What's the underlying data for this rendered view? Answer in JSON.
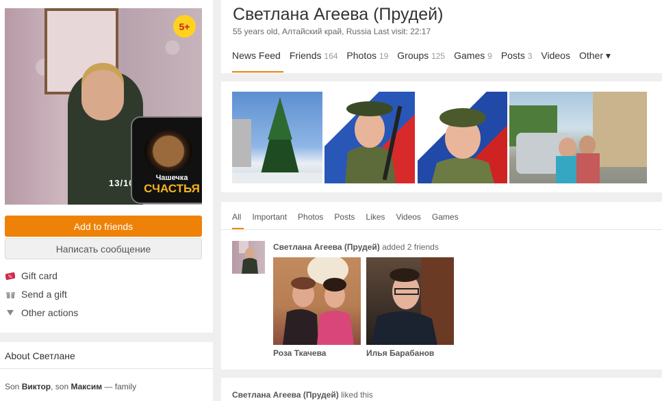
{
  "profile": {
    "name": "Светлана Агеева (Прудей)",
    "subtitle": "55 years old, Алтайский край, Russia  Last visit: 22:17",
    "age_badge": "5+",
    "avatar_stamp": "13/10",
    "sticker_line1": "Чашечка",
    "sticker_line2": "СЧАСТЬЯ"
  },
  "actions": {
    "add_friend": "Add to friends",
    "message": "Написать сообщение",
    "list": [
      {
        "label": "Gift card",
        "icon": "gift-card-icon"
      },
      {
        "label": "Send a gift",
        "icon": "gift-icon"
      },
      {
        "label": "Other actions",
        "icon": "triangle-down-icon"
      }
    ]
  },
  "about": {
    "title": "About Светлане",
    "p1": "Son ",
    "n1": "Виктор",
    "p2": ", son ",
    "n2": "Максим",
    "p3": " — ",
    "relation": "family"
  },
  "nav": {
    "items": [
      {
        "label": "News Feed",
        "count": ""
      },
      {
        "label": "Friends",
        "count": "164"
      },
      {
        "label": "Photos",
        "count": "19"
      },
      {
        "label": "Groups",
        "count": "125"
      },
      {
        "label": "Games",
        "count": "9"
      },
      {
        "label": "Posts",
        "count": "3"
      },
      {
        "label": "Videos",
        "count": ""
      },
      {
        "label": "Other ▾",
        "count": ""
      }
    ],
    "active": "News Feed"
  },
  "feed": {
    "tabs": [
      "All",
      "Important",
      "Photos",
      "Posts",
      "Likes",
      "Videos",
      "Games"
    ],
    "active_tab": "All",
    "event": {
      "actor": "Светлана Агеева (Прудей)",
      "action": " added 2 friends",
      "friends": [
        "Роза Ткачева",
        "Илья Барабанов"
      ]
    },
    "liked": {
      "actor": "Светлана Агеева (Прудей)",
      "action": " liked this"
    }
  },
  "colors": {
    "accent": "#ee8208",
    "badge": "#ffd21f"
  }
}
